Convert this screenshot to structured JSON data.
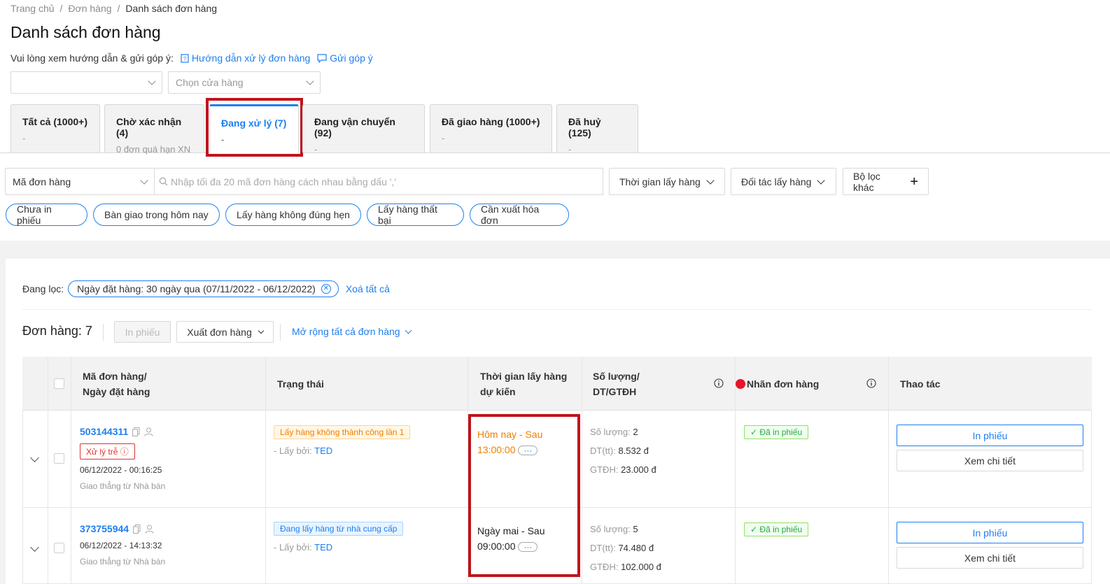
{
  "breadcrumb": [
    "Trang chủ",
    "Đơn hàng",
    "Danh sách đơn hàng"
  ],
  "page_title": "Danh sách đơn hàng",
  "guide": {
    "text": "Vui lòng xem hướng dẫn & gửi góp ý:",
    "link1": "Hướng dẫn xử lý đơn hàng",
    "link2": "Gửi góp ý"
  },
  "selects": {
    "first": "",
    "store_placeholder": "Chọn cửa hàng"
  },
  "tabs": [
    {
      "title": "Tất cả (1000+)",
      "sub": "-"
    },
    {
      "title": "Chờ xác nhận (4)",
      "sub": "0 đơn quá hạn XN"
    },
    {
      "title": "Đang xử lý (7)",
      "sub": "-"
    },
    {
      "title": "Đang vận chuyển (92)",
      "sub": "-"
    },
    {
      "title": "Đã giao hàng (1000+)",
      "sub": "-"
    },
    {
      "title": "Đã huỷ (125)",
      "sub": "-"
    }
  ],
  "search": {
    "type": "Mã đơn hàng",
    "placeholder": "Nhập tối đa 20 mã đơn hàng cách nhau bằng dấu ','"
  },
  "filters": {
    "pickup_time": "Thời gian lấy hàng",
    "pickup_partner": "Đối tác lấy hàng",
    "other": "Bộ lọc khác"
  },
  "chips": [
    "Chưa in phiếu",
    "Bàn giao trong hôm nay",
    "Lấy hàng không đúng hẹn",
    "Lấy hàng thất bại",
    "Cần xuất hóa đơn"
  ],
  "active_filter": {
    "label": "Đang lọc:",
    "tag": "Ngày đặt hàng: 30 ngày qua (07/11/2022 - 06/12/2022)",
    "clear": "Xoá tất cả"
  },
  "toolbar": {
    "count": "Đơn hàng: 7",
    "print": "In phiếu",
    "export": "Xuất đơn hàng",
    "expand": "Mở rộng tất cả đơn hàng"
  },
  "columns": {
    "order_l1": "Mã đơn hàng/",
    "order_l2": "Ngày đặt hàng",
    "status": "Trạng thái",
    "time_l1": "Thời gian lấy hàng",
    "time_l2": "dự kiến",
    "qty_l1": "Số lượng/",
    "qty_l2": "DT/GTĐH",
    "label": "Nhãn đơn hàng",
    "action": "Thao tác"
  },
  "orders": [
    {
      "id": "503144311",
      "late": "Xử lý trễ",
      "date": "06/12/2022 - 00:16:25",
      "ship": "Giao thẳng từ Nhà bán",
      "status": "Lấy hàng không thành công lần 1",
      "picked_by_label": "- Lấy bởi:",
      "picked_by": "TED",
      "time_l1": "Hôm nay - Sau",
      "time_l2": "13:00:00",
      "qty_label": "Số lượng:",
      "qty": "2",
      "dt_label": "DT(tt):",
      "dt": "8.532 đ",
      "gt_label": "GTĐH:",
      "gt": "23.000 đ",
      "tag": "Đã in phiếu",
      "btn_print": "In phiếu",
      "btn_detail": "Xem chi tiết"
    },
    {
      "id": "373755944",
      "date": "06/12/2022 - 14:13:32",
      "ship": "Giao thẳng từ Nhà bán",
      "status": "Đang lấy hàng từ nhà cung cấp",
      "picked_by_label": "- Lấy bởi:",
      "picked_by": "TED",
      "time_l1": "Ngày mai - Sau",
      "time_l2": "09:00:00",
      "qty_label": "Số lượng:",
      "qty": "5",
      "dt_label": "DT(tt):",
      "dt": "74.480 đ",
      "gt_label": "GTĐH:",
      "gt": "102.000 đ",
      "tag": "Đã in phiếu",
      "btn_print": "In phiếu",
      "btn_detail": "Xem chi tiết"
    }
  ],
  "colors": {
    "accent": "#1e7ff0",
    "highlight": "#c0141c",
    "late": "#f07d00"
  }
}
